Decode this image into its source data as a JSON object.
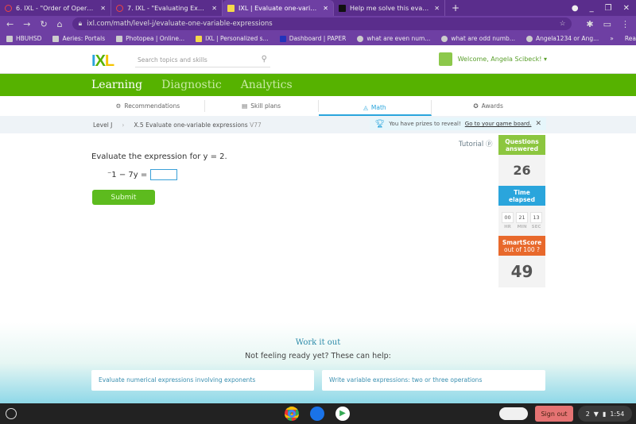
{
  "browser": {
    "tabs": [
      {
        "title": "6. IXL - \"Order of Operations Pra",
        "icon": "ixl-red-circle-icon"
      },
      {
        "title": "7. IXL - \"Evaluating Expressions\"",
        "icon": "ixl-red-circle-icon"
      },
      {
        "title": "IXL | Evaluate one-variable expre",
        "icon": "ixl-favicon",
        "active": true
      },
      {
        "title": "Help me solve this evaluating ex",
        "icon": "brainly-favicon"
      }
    ],
    "url": "ixl.com/math/level-j/evaluate-one-variable-expressions",
    "bookmarks": [
      "HBUHSD",
      "Aeries: Portals",
      "Photopea | Online...",
      "IXL | Personalized s...",
      "Dashboard | PAPER",
      "what are even num...",
      "what are odd numb...",
      "Angela1234 or Ang..."
    ],
    "reading_list": "Reading list"
  },
  "header": {
    "logo": "IXL",
    "search_placeholder": "Search topics and skills",
    "welcome": "Welcome, Angela Scibeck! ▾"
  },
  "nav": [
    "Learning",
    "Diagnostic",
    "Analytics"
  ],
  "subnav": [
    "Recommendations",
    "Skill plans",
    "Math",
    "Awards"
  ],
  "breadcrumb": {
    "level": "Level J",
    "skill": "X.5 Evaluate one-variable expressions",
    "code": "V77"
  },
  "prize": {
    "text": "You have prizes to reveal!",
    "link": "Go to your game board."
  },
  "question": {
    "prompt": "Evaluate the expression for y = 2.",
    "expression": "⁻1 − 7y =",
    "answer": "",
    "submit": "Submit"
  },
  "tutorial": "Tutorial ⓟ",
  "stats": {
    "questions_label_1": "Questions",
    "questions_label_2": "answered",
    "questions": "26",
    "time_label_1": "Time",
    "time_label_2": "elapsed",
    "hr": "00",
    "min": "21",
    "sec": "13",
    "hr_l": "HR",
    "min_l": "MIN",
    "sec_l": "SEC",
    "score_label": "SmartScore",
    "score_sub": "out of 100 ?",
    "score": "49"
  },
  "help": {
    "title": "Work it out",
    "subtitle": "Not feeling ready yet? These can help:",
    "links": [
      "Evaluate numerical expressions involving exponents",
      "Write variable expressions: two or three operations"
    ]
  },
  "shelf": {
    "sign_out": "Sign out",
    "notifications": "2",
    "time": "1:54"
  },
  "colors": {
    "green": "#56b200",
    "blue": "#2aa5dc",
    "orange": "#e8692c",
    "lime": "#8cc63f",
    "purple": "#6e3fa3"
  }
}
